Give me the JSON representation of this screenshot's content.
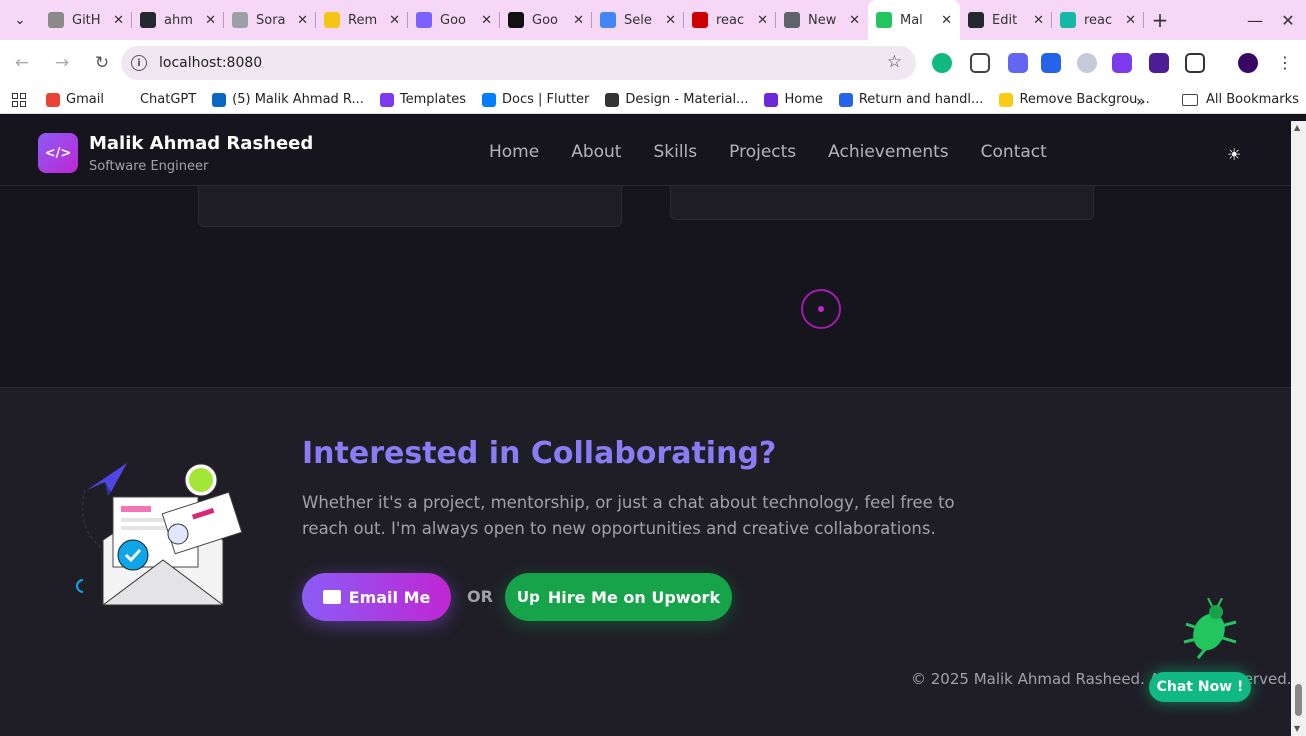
{
  "browser": {
    "tabs": [
      {
        "label": "GitH",
        "color": "#8a8a8a"
      },
      {
        "label": "ahm",
        "color": "#24292f"
      },
      {
        "label": "Sora",
        "color": "#9aa0a6"
      },
      {
        "label": "Rem",
        "color": "#f5c518"
      },
      {
        "label": "Goo",
        "color": "#7b61ff"
      },
      {
        "label": "Goo",
        "color": "#111111"
      },
      {
        "label": "Sele",
        "color": "#4285f4"
      },
      {
        "label": "reac",
        "color": "#cc0000"
      },
      {
        "label": "New",
        "color": "#5f6368"
      },
      {
        "label": "Mal",
        "color": "#22c55e"
      },
      {
        "label": "Edit",
        "color": "#24292f"
      },
      {
        "label": "reac",
        "color": "#14b8a6"
      }
    ],
    "address": "localhost:8080",
    "bookmarks": [
      {
        "label": "Gmail",
        "color": "#ea4335"
      },
      {
        "label": "ChatGPT",
        "color": "#ffffff"
      },
      {
        "label": "(5) Malik Ahmad R...",
        "color": "#0a66c2"
      },
      {
        "label": "Templates",
        "color": "#7c3aed"
      },
      {
        "label": "Docs | Flutter",
        "color": "#027dfd"
      },
      {
        "label": "Design - Material...",
        "color": "#333333"
      },
      {
        "label": "Home",
        "color": "#6d28d9"
      },
      {
        "label": "Return and handl...",
        "color": "#2563eb"
      },
      {
        "label": "Remove Backgrou...",
        "color": "#facc15"
      }
    ],
    "all_bookmarks": "All Bookmarks"
  },
  "header": {
    "name": "Malik Ahmad Rasheed",
    "role": "Software Engineer",
    "logo_symbol": "</>",
    "nav": [
      "Home",
      "About",
      "Skills",
      "Projects",
      "Achievements",
      "Contact"
    ]
  },
  "footer": {
    "title": "Interested in Collaborating?",
    "description": "Whether it's a project, mentorship, or just a chat about technology, feel free to reach out. I'm always open to new opportunities and creative collaborations.",
    "email_button": "Email Me",
    "or_label": "OR",
    "upwork_button": "Hire Me on Upwork",
    "upwork_icon": "Up",
    "copyright": "© 2025 Malik Ahmad Rasheed. All rights reserved.",
    "chat_button": "Chat Now !"
  },
  "colors": {
    "accent_purple": "#8b5cf6",
    "upwork_green": "#16a34a",
    "chat_green": "#10b981"
  }
}
